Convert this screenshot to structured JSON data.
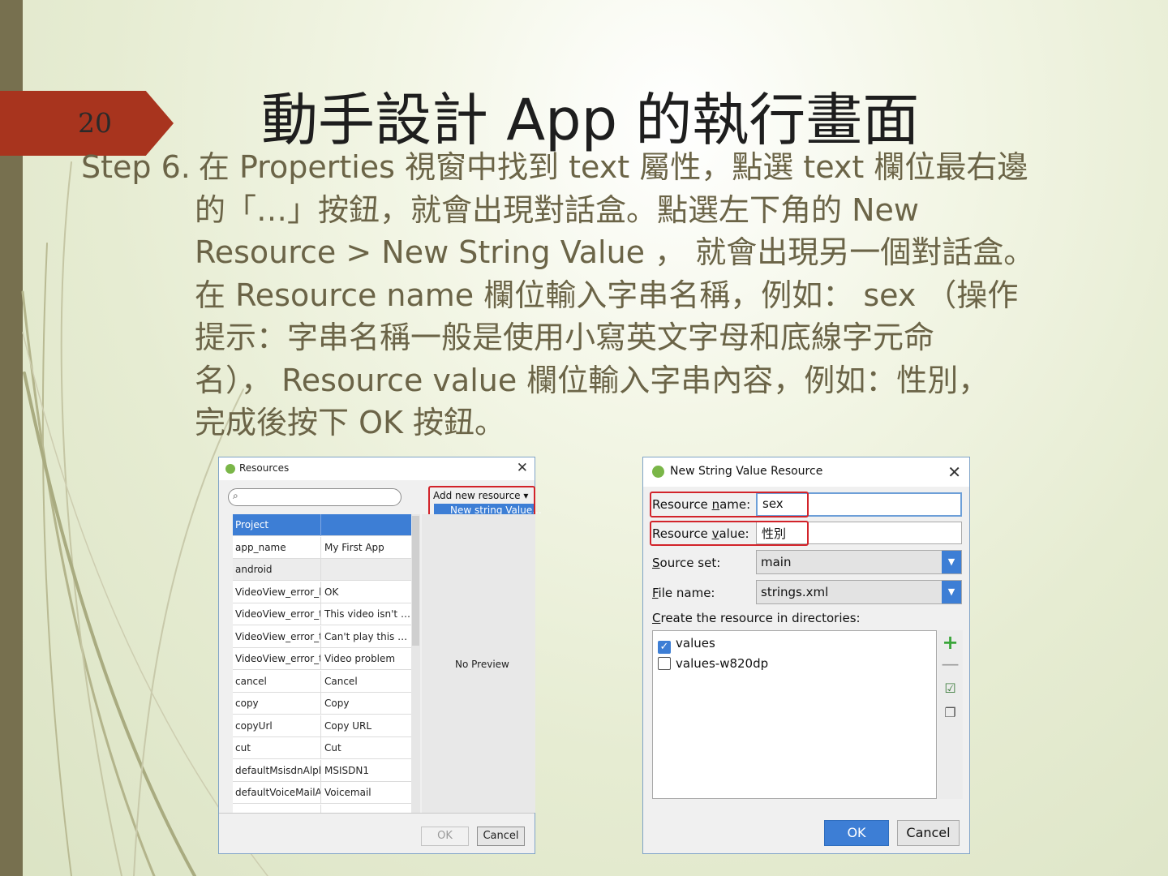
{
  "slide": {
    "page_number": "20",
    "title": "動手設計 App 的執行畫面",
    "step_label": "Step 6.",
    "lines": [
      "在 Properties 視窗中找到 text 屬性，點選 text 欄位最右邊",
      "的「…」按鈕，就會出現對話盒。點選左下角的 New",
      "Resource > New String Value ， 就會出現另一個對話盒。",
      "在 Resource name 欄位輸入字串名稱，例如： sex （操作",
      "提示：字串名稱一般是使用小寫英文字母和底線字元命",
      "名）， Resource value 欄位輸入字串內容，例如：性別，",
      "完成後按下 OK 按鈕。"
    ],
    "accent_color": "#a8341e"
  },
  "resources_dialog": {
    "title": "Resources",
    "close_glyph": "✕",
    "search_placeholder": "",
    "add_new_resource": "Add new resource ▾",
    "dropdown_item": "New string Value...",
    "no_preview": "No Preview",
    "ok_label": "OK",
    "cancel_label": "Cancel",
    "rows": [
      {
        "name": "Project",
        "value": "",
        "kind": "header"
      },
      {
        "name": "app_name",
        "value": "My First App",
        "kind": "row"
      },
      {
        "name": "android",
        "value": "",
        "kind": "group"
      },
      {
        "name": "VideoView_error_button",
        "value": "OK",
        "kind": "row"
      },
      {
        "name": "VideoView_error_text_invalid_progressive_playback",
        "value": "This video isn't valid for streaming",
        "kind": "row"
      },
      {
        "name": "VideoView_error_text_unknown",
        "value": "Can't play this video.",
        "kind": "row"
      },
      {
        "name": "VideoView_error_title",
        "value": "Video problem",
        "kind": "row"
      },
      {
        "name": "cancel",
        "value": "Cancel",
        "kind": "row"
      },
      {
        "name": "copy",
        "value": "Copy",
        "kind": "row"
      },
      {
        "name": "copyUrl",
        "value": "Copy URL",
        "kind": "row"
      },
      {
        "name": "cut",
        "value": "Cut",
        "kind": "row"
      },
      {
        "name": "defaultMsisdnAlphaTag",
        "value": "MSISDN1",
        "kind": "row"
      },
      {
        "name": "defaultVoiceMailAlphaTag",
        "value": "Voicemail",
        "kind": "row"
      },
      {
        "name": "",
        "value": "",
        "kind": "row"
      }
    ]
  },
  "new_string_dialog": {
    "title": "New String Value Resource",
    "close_glyph": "✕",
    "resource_name_label_pre": "Resource ",
    "resource_name_label_mn": "n",
    "resource_name_label_post": "ame:",
    "resource_name_value": "sex",
    "resource_value_label_pre": "Resource ",
    "resource_value_label_mn": "v",
    "resource_value_label_post": "alue:",
    "resource_value_value": "性別",
    "source_set_label_mn": "S",
    "source_set_label_post": "ource set:",
    "source_set_value": "main",
    "file_name_label_mn": "F",
    "file_name_label_post": "ile name:",
    "file_name_value": "strings.xml",
    "directories_label_mn": "C",
    "directories_label_post": "reate the resource in directories:",
    "directories": [
      {
        "name": "values",
        "checked": true
      },
      {
        "name": "values-w820dp",
        "checked": false
      }
    ],
    "ok_label": "OK",
    "cancel_label": "Cancel",
    "highlight_color": "#d2232a",
    "accent_color": "#3d7ed5"
  }
}
